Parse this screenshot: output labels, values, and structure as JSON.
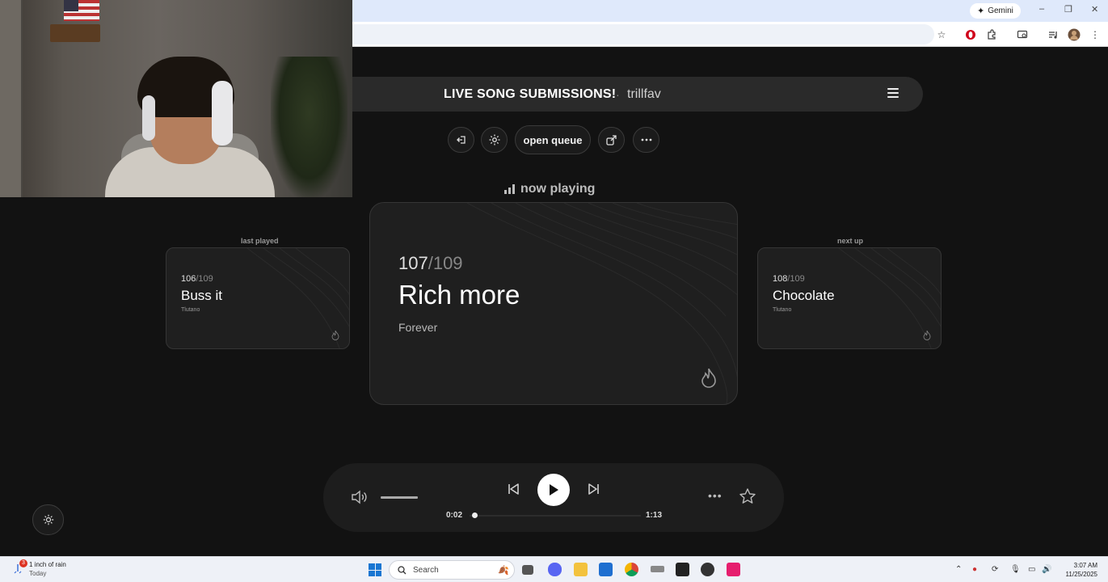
{
  "browser": {
    "gemini_label": "Gemini",
    "window_controls": [
      "–",
      "❐",
      "✕"
    ]
  },
  "header": {
    "title": "LIVE SONG SUBMISSIONS!",
    "separator": "·",
    "username": "trillfav"
  },
  "actions": {
    "open_queue_label": "open queue"
  },
  "now_playing_label": "now playing",
  "last_played": {
    "label": "last played",
    "index": "106",
    "total": "/109",
    "title": "Buss it",
    "artist": "Tlutano"
  },
  "current": {
    "index": "107",
    "total": "/109",
    "title": "Rich more",
    "artist": "Forever"
  },
  "next_up": {
    "label": "next up",
    "index": "108",
    "total": "/109",
    "title": "Chocolate",
    "artist": "Tlutano"
  },
  "player": {
    "current_time": "0:02",
    "total_time": "1:13",
    "progress_fraction": 0.03,
    "volume_fraction": 1.0
  },
  "taskbar": {
    "weather_badge": "3",
    "weather_title": "1 inch of rain",
    "weather_sub": "Today",
    "search_placeholder": "Search",
    "time": "3:07 AM",
    "date": "11/25/2025"
  },
  "colors": {
    "background": "#121212",
    "card": "#1f1f1f",
    "accent": "#ffffff"
  }
}
